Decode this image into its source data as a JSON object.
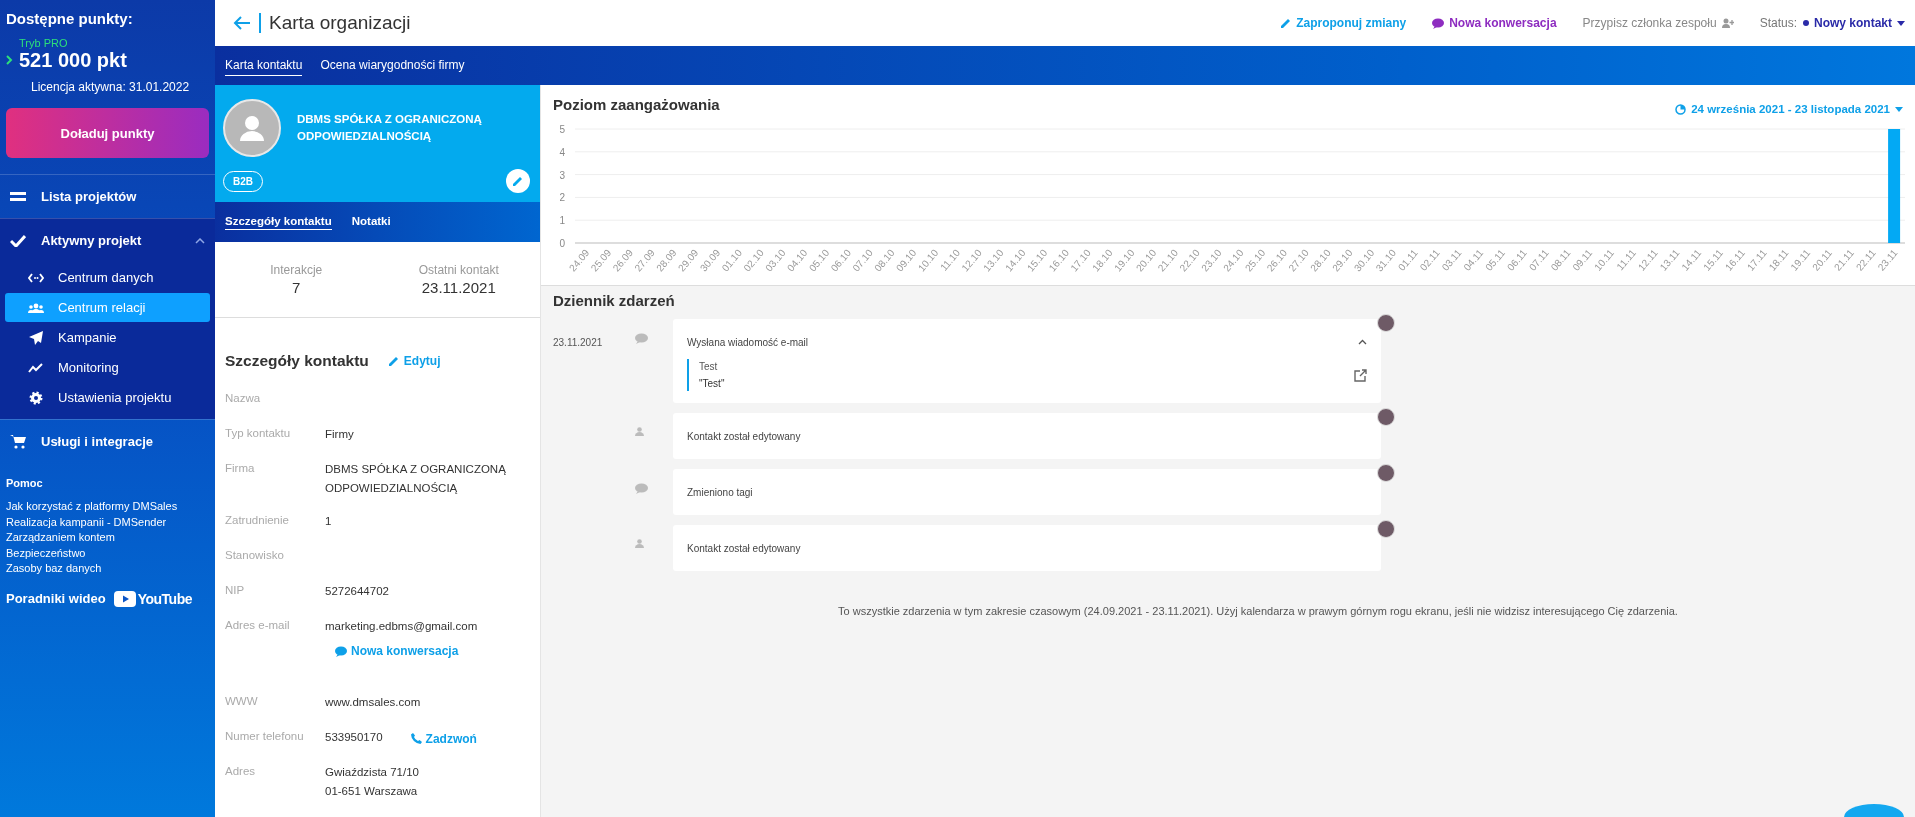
{
  "sidebar": {
    "points_title": "Dostępne punkty:",
    "mode": "Tryb PRO",
    "points": "521 000 pkt",
    "license": "Licencja aktywna: 31.01.2022",
    "topup_button": "Doładuj punkty",
    "nav": [
      {
        "label": "Lista projektów"
      },
      {
        "label": "Aktywny projekt",
        "expanded": true,
        "children": [
          {
            "label": "Centrum danych",
            "selected": false
          },
          {
            "label": "Centrum relacji",
            "selected": true
          },
          {
            "label": "Kampanie",
            "selected": false
          },
          {
            "label": "Monitoring",
            "selected": false
          },
          {
            "label": "Ustawienia projektu",
            "selected": false
          }
        ]
      },
      {
        "label": "Usługi i integracje"
      }
    ],
    "help_title": "Pomoc",
    "help_links": [
      "Jak korzystać z platformy DMSales",
      "Realizacja kampanii - DMSender",
      "Zarządzaniem kontem",
      "Bezpieczeństwo",
      "Zasoby baz danych"
    ],
    "video_label": "Poradniki wideo",
    "video_logo": "YouTube"
  },
  "topbar": {
    "title": "Karta organizacji",
    "actions": [
      "Zaproponuj zmiany",
      "Nowa konwersacja",
      "Przypisz członka zespołu"
    ],
    "status_label": "Status:",
    "status_value": "Nowy kontakt",
    "tabs": [
      {
        "label": "Karta kontaktu",
        "selected": true
      },
      {
        "label": "Ocena wiarygodności firmy",
        "selected": false
      }
    ]
  },
  "contact": {
    "name": "DBMS SPÓŁKA Z OGRANICZONĄ ODPOWIEDZIALNOŚCIĄ",
    "tag": "B2B",
    "tabs": [
      {
        "label": "Szczegóły kontaktu",
        "selected": true
      },
      {
        "label": "Notatki",
        "selected": false
      }
    ],
    "stats": [
      {
        "label": "Interakcje",
        "value": "7"
      },
      {
        "label": "Ostatni kontakt",
        "value": "23.11.2021"
      }
    ],
    "details_title": "Szczegóły kontaktu",
    "edit_link": "Edytuj",
    "fields": [
      {
        "label": "Nazwa"
      },
      {
        "label": "Typ kontaktu",
        "value": "Firmy"
      },
      {
        "label": "Firma",
        "value": "DBMS SPÓŁKA Z OGRANICZONĄ ODPOWIEDZIALNOŚCIĄ"
      },
      {
        "label": "Zatrudnienie",
        "value": "1"
      },
      {
        "label": "Stanowisko"
      },
      {
        "label": "NIP",
        "value": "5272644702"
      },
      {
        "label": "Adres e-mail",
        "value": "marketing.edbms@gmail.com",
        "action": {
          "kind": "chat",
          "label": "Nowa konwersacja"
        }
      },
      {
        "label": "WWW",
        "value": "www.dmsales.com"
      },
      {
        "label": "Numer telefonu",
        "value": "533950170",
        "action": {
          "kind": "call",
          "label": "Zadzwoń"
        }
      },
      {
        "label": "Adres",
        "value": "Gwiaździsta 71/10\n01-651 Warszawa"
      }
    ]
  },
  "engagement": {
    "title": "Poziom zaangażowania",
    "date_range": "24 września 2021 - 23 listopada 2021",
    "chart_data": {
      "type": "bar",
      "categories": [
        "24.09",
        "25.09",
        "26.09",
        "27.09",
        "28.09",
        "29.09",
        "30.09",
        "01.10",
        "02.10",
        "03.10",
        "04.10",
        "05.10",
        "06.10",
        "07.10",
        "08.10",
        "09.10",
        "10.10",
        "11.10",
        "12.10",
        "13.10",
        "14.10",
        "15.10",
        "16.10",
        "17.10",
        "18.10",
        "19.10",
        "20.10",
        "21.10",
        "22.10",
        "23.10",
        "24.10",
        "25.10",
        "26.10",
        "27.10",
        "28.10",
        "29.10",
        "30.10",
        "31.10",
        "01.11",
        "02.11",
        "03.11",
        "04.11",
        "05.11",
        "06.11",
        "07.11",
        "08.11",
        "09.11",
        "10.11",
        "11.11",
        "12.11",
        "13.11",
        "14.11",
        "15.11",
        "16.11",
        "17.11",
        "18.11",
        "19.11",
        "20.11",
        "21.11",
        "22.11",
        "23.11"
      ],
      "values": [
        0,
        0,
        0,
        0,
        0,
        0,
        0,
        0,
        0,
        0,
        0,
        0,
        0,
        0,
        0,
        0,
        0,
        0,
        0,
        0,
        0,
        0,
        0,
        0,
        0,
        0,
        0,
        0,
        0,
        0,
        0,
        0,
        0,
        0,
        0,
        0,
        0,
        0,
        0,
        0,
        0,
        0,
        0,
        0,
        0,
        0,
        0,
        0,
        0,
        0,
        0,
        0,
        0,
        0,
        0,
        0,
        0,
        0,
        0,
        0,
        5
      ],
      "ylim": [
        0,
        5
      ],
      "yticks": [
        0,
        1,
        2,
        3,
        4,
        5
      ],
      "grid": true
    }
  },
  "log": {
    "title": "Dziennik zdarzeń",
    "events": [
      {
        "date": "23.11.2021",
        "kind": "message",
        "text": "Wysłana wiadomość e-mail",
        "expanded": true,
        "detail_title": "Test",
        "detail_body": "\"Test\""
      },
      {
        "kind": "user",
        "text": "Kontakt został edytowany"
      },
      {
        "kind": "message",
        "text": "Zmieniono tagi"
      },
      {
        "kind": "user",
        "text": "Kontakt został edytowany"
      }
    ],
    "note": "To wszystkie zdarzenia w tym zakresie czasowym (24.09.2021 - 23.11.2021). Użyj kalendarza w prawym górnym rogu ekranu, jeśli nie widzisz interesującego Cię zdarzenia."
  }
}
